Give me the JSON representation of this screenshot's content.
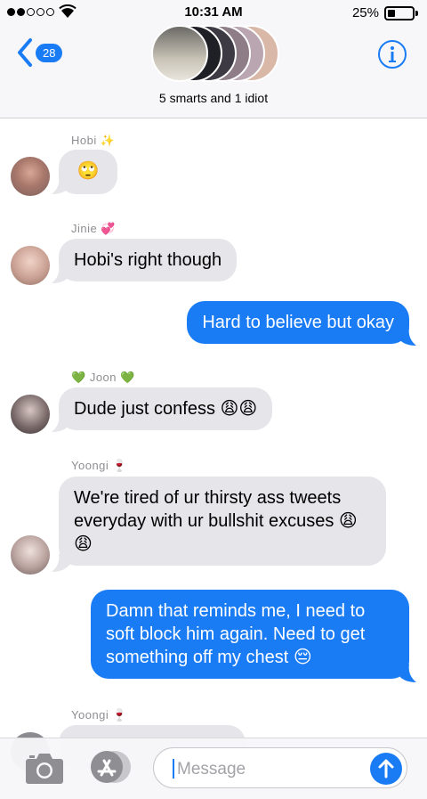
{
  "status": {
    "time": "10:31 AM",
    "battery": "25%"
  },
  "header": {
    "back_count": "28",
    "group_name": "5 smarts and 1 idiot"
  },
  "messages": [
    {
      "sender": "Hobi",
      "sender_emoji": "✨",
      "text": "🙄"
    },
    {
      "sender": "Jinie",
      "sender_emoji": "💞",
      "text": "Hobi's right though"
    },
    {
      "text": "Hard to believe but okay"
    },
    {
      "sender": "Joon",
      "sender_prefix": "💚",
      "sender_emoji": "💚",
      "text": "Dude just confess 😩😩"
    },
    {
      "sender": "Yoongi",
      "sender_emoji": "🍷",
      "text": "We're tired of ur thirsty ass tweets everyday with ur bullshit excuses 😩😩"
    },
    {
      "text": "Damn that reminds me, I need to soft block him again. Need to get something off my chest 😔"
    },
    {
      "sender": "Yoongi",
      "sender_emoji": "🍷"
    }
  ],
  "input": {
    "placeholder": "Message"
  },
  "colors": {
    "accent": "#1a7cf5",
    "incoming_bubble": "#e5e5ea",
    "header_bg": "#f7f7f9"
  },
  "icons": [
    "wifi-icon",
    "battery-icon",
    "back-chevron-icon",
    "info-icon",
    "camera-icon",
    "app-store-icon",
    "send-arrow-icon"
  ]
}
